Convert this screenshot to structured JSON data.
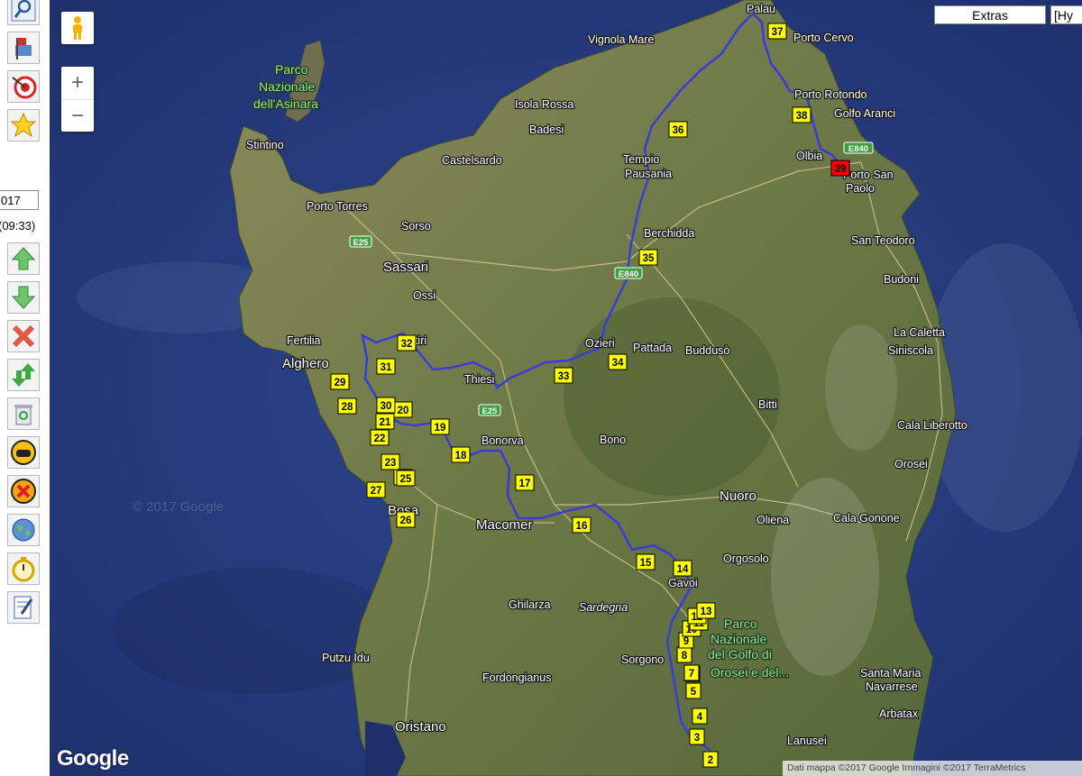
{
  "sidebar": {
    "date_value": "017",
    "time_value": "(09:33)",
    "buttons": [
      {
        "icon": "search-icon",
        "name": "search-button"
      },
      {
        "icon": "mailbox-flag-icon",
        "name": "import-button"
      },
      {
        "icon": "target-icon",
        "name": "target-button"
      },
      {
        "icon": "star-icon",
        "name": "favorite-button"
      },
      {
        "icon": "arrow-up-icon",
        "name": "move-up-button"
      },
      {
        "icon": "arrow-down-icon",
        "name": "move-down-button"
      },
      {
        "icon": "delete-x-icon",
        "name": "delete-button"
      },
      {
        "icon": "swap-arrows-icon",
        "name": "reverse-button"
      },
      {
        "icon": "trash-icon",
        "name": "trash-button"
      },
      {
        "icon": "car-icon",
        "name": "car-button"
      },
      {
        "icon": "cancel-circle-icon",
        "name": "cancel-button"
      },
      {
        "icon": "globe-icon",
        "name": "globe-button"
      },
      {
        "icon": "stopwatch-icon",
        "name": "timer-button"
      },
      {
        "icon": "edit-document-icon",
        "name": "edit-button"
      }
    ]
  },
  "map": {
    "controls": {
      "zoom_in": "+",
      "zoom_out": "−",
      "pegman_icon": "pegman-icon"
    },
    "extras_label": "Extras",
    "maptype_label": "[Hy",
    "google_logo": "Google",
    "watermark": "© 2017 Google",
    "copyright": "Dati mappa ©2017 Google Immagini ©2017 TerraMetrics",
    "places": [
      "Palau",
      "Porto Cervo",
      "Vignola Mare",
      "Isola Rossa",
      "Porto Rotondo",
      "Golfo Aranci",
      "Badesi",
      "Stintino",
      "Castelsardo",
      "Tempio",
      "Pausania",
      "Olbia",
      "Porto San",
      "Paolo",
      "Porto Torres",
      "Sorso",
      "Berchidda",
      "San Teodoro",
      "Sassari",
      "Ossi",
      "Budoni",
      "Fertilia",
      "Alghero",
      "Ittiri",
      "Thiesi",
      "Ozieri",
      "Pattada",
      "Buddusò",
      "La Caletta",
      "Siniscola",
      "Bitti",
      "Cala Liberotto",
      "Bonorva",
      "Bono",
      "Orosei",
      "Bosa",
      "Macomer",
      "Nuoro",
      "Oliena",
      "Cala Gonone",
      "Orgosolo",
      "Gavoi",
      "Ghilarza",
      "Sardegna",
      "Sorgono",
      "Putzu Idu",
      "Fordongianus",
      "Santa Maria",
      "Navarrese",
      "Arbatax",
      "Oristano",
      "Lanusei",
      "Parco",
      "Nazionale",
      "dell'Asinara",
      "Parco",
      "Nazionale",
      "del Golfo di",
      "Orosei e del..."
    ],
    "roads": [
      "E25",
      "E840",
      "E840",
      "E25"
    ],
    "route_color": "#3b3bd6",
    "waypoint_color": "#ffff00",
    "finish_color": "#ff0000",
    "waypoints": [
      "2",
      "3",
      "4",
      "5",
      "6",
      "7",
      "8",
      "9",
      "10",
      "11",
      "12",
      "13",
      "14",
      "15",
      "16",
      "17",
      "18",
      "19",
      "20",
      "21",
      "22",
      "23",
      "24",
      "25",
      "26",
      "27",
      "28",
      "29",
      "30",
      "31",
      "32",
      "33",
      "34",
      "35",
      "36",
      "37",
      "38",
      "39"
    ]
  }
}
